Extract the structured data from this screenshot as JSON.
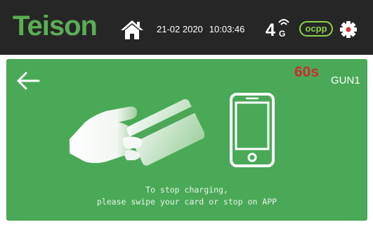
{
  "header": {
    "brand": "Teison",
    "date": "21-02 2020",
    "time": "10:03:46",
    "network": "4",
    "network_sub": "G",
    "ocpp_badge": "ocpp"
  },
  "panel": {
    "countdown": "60s",
    "gun_label": "GUN1",
    "instruction_line1": "To stop charging,",
    "instruction_line2": "please swipe your card or stop on APP"
  },
  "icons": {
    "home": "home-icon",
    "gear": "gear-icon",
    "back": "back-arrow-icon",
    "card": "swipe-card-icon",
    "phone": "smartphone-icon"
  },
  "colors": {
    "topbar": "#262626",
    "brand_green": "#5aae54",
    "panel_green": "#4aa957",
    "ocpp_green": "#8bd14a",
    "countdown_red": "#c8302a"
  }
}
